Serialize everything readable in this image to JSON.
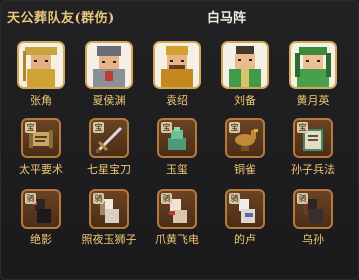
{
  "header": {
    "title": "天公葬队友(群伤)",
    "subtitle": "白马阵"
  },
  "heroes": [
    {
      "name": "张角",
      "icon": "zhangjiao-portrait"
    },
    {
      "name": "夏侯渊",
      "icon": "xiahouyuan-portrait"
    },
    {
      "name": "袁绍",
      "icon": "yuanshao-portrait"
    },
    {
      "name": "刘备",
      "icon": "liubei-portrait"
    },
    {
      "name": "黄月英",
      "icon": "huangyueying-portrait"
    }
  ],
  "treasures": [
    {
      "name": "太平要术",
      "badge": "宝",
      "icon": "scroll-icon"
    },
    {
      "name": "七星宝刀",
      "badge": "宝",
      "icon": "sword-icon"
    },
    {
      "name": "玉玺",
      "badge": "宝",
      "icon": "jade-seal-icon"
    },
    {
      "name": "铜雀",
      "badge": "宝",
      "icon": "bronze-bird-icon"
    },
    {
      "name": "孙子兵法",
      "badge": "宝",
      "icon": "book-icon"
    }
  ],
  "mounts": [
    {
      "name": "绝影",
      "badge": "骑",
      "icon": "black-horse-icon"
    },
    {
      "name": "照夜玉狮子",
      "badge": "骑",
      "icon": "white-lion-horse-icon"
    },
    {
      "name": "爪黄飞电",
      "badge": "骑",
      "icon": "yellow-claw-horse-icon"
    },
    {
      "name": "的卢",
      "badge": "骑",
      "icon": "dilu-horse-icon"
    },
    {
      "name": "乌孙",
      "badge": "骑",
      "icon": "wusun-horse-icon"
    }
  ]
}
